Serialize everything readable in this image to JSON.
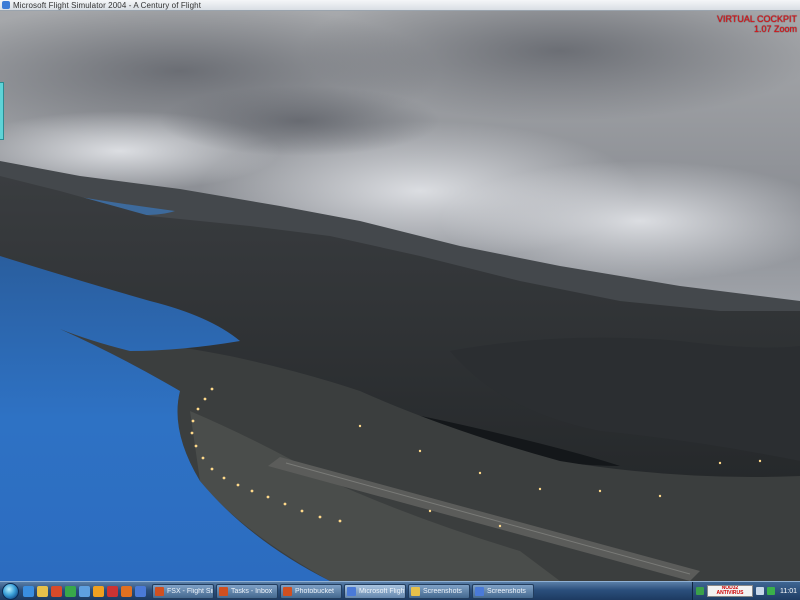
{
  "window": {
    "title": "Microsoft Flight Simulator 2004 - A Century of Flight"
  },
  "hud": {
    "view_mode": "VIRTUAL COCKPIT",
    "zoom": "1.07 Zoom"
  },
  "taskbar": {
    "quick_launch": [
      {
        "icon": "browser-icon",
        "color": "#3a8ee0"
      },
      {
        "icon": "folder-icon",
        "color": "#e6c04a"
      },
      {
        "icon": "media-icon",
        "color": "#d84a2a"
      },
      {
        "icon": "messenger-icon",
        "color": "#38a84a"
      },
      {
        "icon": "monitor-icon",
        "color": "#5fa0e0"
      },
      {
        "icon": "chat-icon",
        "color": "#f0a020"
      },
      {
        "icon": "download-icon",
        "color": "#cc3333"
      },
      {
        "icon": "firefox-icon",
        "color": "#e07020"
      },
      {
        "icon": "help-icon",
        "color": "#4a7ad8"
      }
    ],
    "tasks": [
      {
        "label": "FSX - Flight Sim",
        "icon_color": "#d05020",
        "active": false
      },
      {
        "label": "Tasks - Inbox",
        "icon_color": "#d05020",
        "active": false
      },
      {
        "label": "Photobucket",
        "icon_color": "#d05020",
        "active": false
      },
      {
        "label": "Microsoft Flight",
        "icon_color": "#4a7ad8",
        "active": true
      },
      {
        "label": "Screenshots",
        "icon_color": "#e6c04a",
        "active": false
      },
      {
        "label": "Screenshots",
        "icon_color": "#4a7ad8",
        "active": false
      }
    ],
    "tray": {
      "badge_text": "NOD32 ANTIVIRUS",
      "clock": "11:01"
    }
  }
}
